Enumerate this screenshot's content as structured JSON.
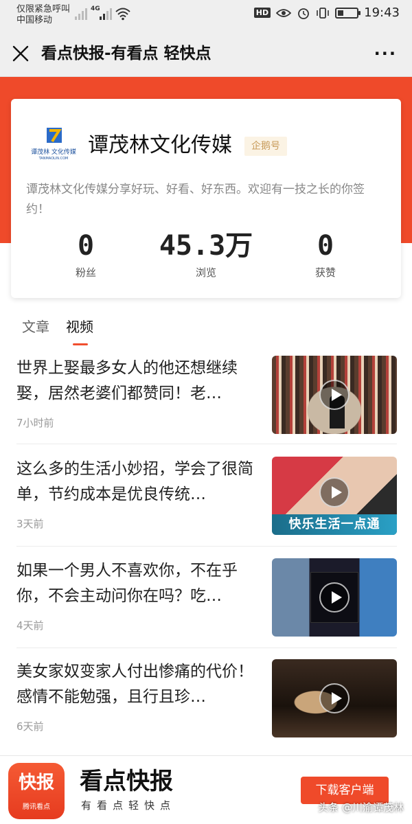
{
  "status_bar": {
    "carrier_line1": "仅限紧急呼叫",
    "carrier_line2": "中国移动",
    "network": "4G",
    "hd": "HD",
    "time": "19:43"
  },
  "nav": {
    "title": "看点快报-有看点 轻快点",
    "more": "···"
  },
  "profile": {
    "logo_text": "谭茂林 文化传媒",
    "logo_sub": "TANMAOLIN.COM",
    "name": "谭茂林文化传媒",
    "badge": "企鹅号",
    "bio": "谭茂林文化传媒分享好玩、好看、好东西。欢迎有一技之长的你签约！",
    "stats": [
      {
        "value": "0",
        "label": "粉丝"
      },
      {
        "value": "45.3万",
        "label": "浏览"
      },
      {
        "value": "0",
        "label": "获赞"
      }
    ]
  },
  "tabs": {
    "articles": "文章",
    "videos": "视频"
  },
  "videos": [
    {
      "title": "世界上娶最多女人的他还想继续娶，居然老婆们都赞同！老…",
      "time": "7小时前",
      "caption": ""
    },
    {
      "title": "这么多的生活小妙招，学会了很简单，节约成本是优良传统…",
      "time": "3天前",
      "caption": "快乐生活一点通"
    },
    {
      "title": "如果一个男人不喜欢你，不在乎你，不会主动问你在吗？吃…",
      "time": "4天前",
      "caption": ""
    },
    {
      "title": "美女家奴变家人付出惨痛的代价！感情不能勉强，且行且珍…",
      "time": "6天前",
      "caption": ""
    }
  ],
  "footer": {
    "icon_main": "快报",
    "icon_sub": "腾讯看点",
    "app_name": "看点快报",
    "slogan": "有看点轻快点",
    "download": "下载客户端",
    "watermark": "头条 @川渝谭茂林"
  },
  "colors": {
    "accent": "#ef4a2a",
    "badge_text": "#c89b5a"
  }
}
